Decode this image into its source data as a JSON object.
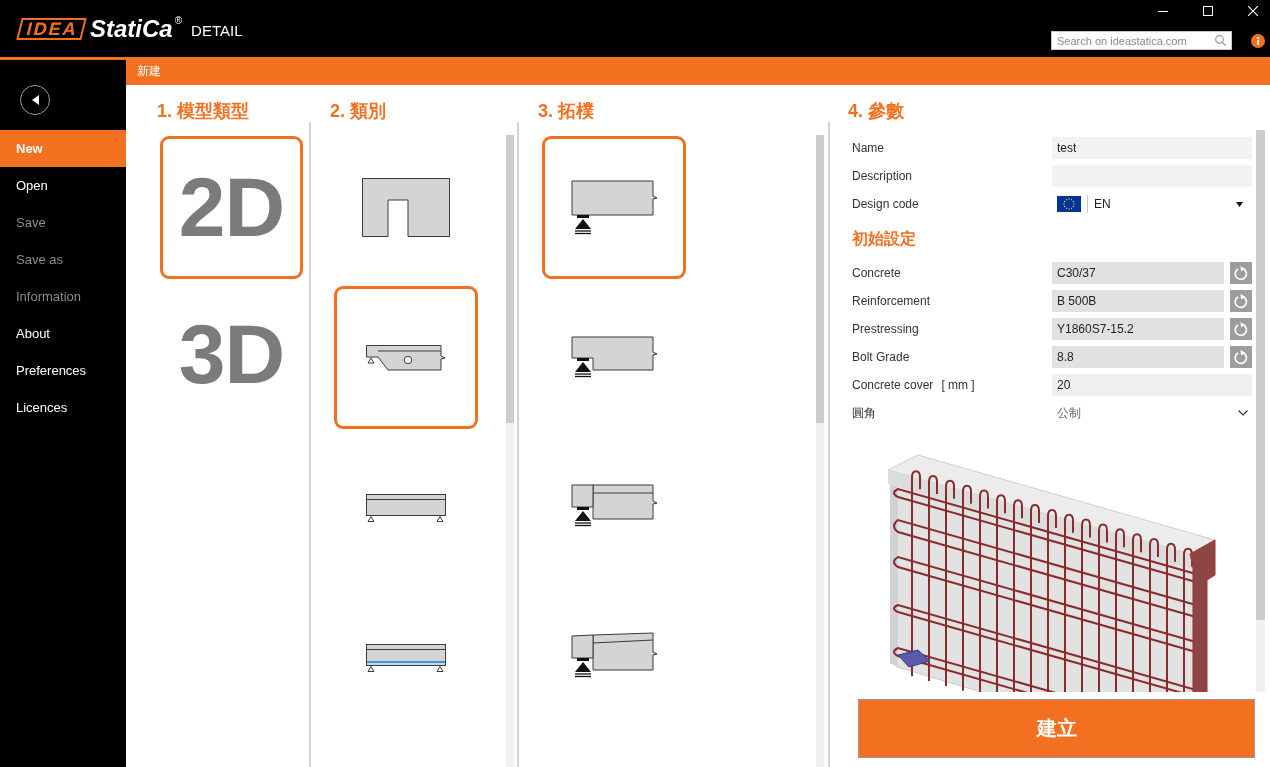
{
  "window": {
    "logo": {
      "brand": "IDEA",
      "name": "StatiCa",
      "mark": "®"
    },
    "product": "DETAIL",
    "search": {
      "placeholder": "Search on ideastatica.com"
    }
  },
  "breadcrumb": "新建",
  "sidebar": {
    "items": [
      {
        "label": "New",
        "selected": true,
        "disabled": false
      },
      {
        "label": "Open",
        "selected": false,
        "disabled": false
      },
      {
        "label": "Save",
        "selected": false,
        "disabled": true
      },
      {
        "label": "Save as",
        "selected": false,
        "disabled": true
      },
      {
        "label": "Information",
        "selected": false,
        "disabled": true
      },
      {
        "label": "About",
        "selected": false,
        "disabled": false
      },
      {
        "label": "Preferences",
        "selected": false,
        "disabled": false
      },
      {
        "label": "Licences",
        "selected": false,
        "disabled": false
      }
    ]
  },
  "model_types": {
    "title": "1. 模型類型",
    "items": [
      {
        "label": "2D",
        "selected": true
      },
      {
        "label": "3D",
        "selected": false
      }
    ]
  },
  "categories": {
    "title": "2. 類別",
    "items": [
      {
        "kind": "opening",
        "selected": false
      },
      {
        "kind": "end-block",
        "selected": true
      },
      {
        "kind": "beam",
        "selected": false
      },
      {
        "kind": "prestressed",
        "selected": false
      }
    ]
  },
  "topologies": {
    "title": "3. 拓樸",
    "items": [
      {
        "kind": "bearing",
        "selected": true
      },
      {
        "kind": "dapped",
        "selected": false
      },
      {
        "kind": "ledge",
        "selected": false
      },
      {
        "kind": "tapered",
        "selected": false
      }
    ]
  },
  "parameters": {
    "title": "4. 參數",
    "fields": [
      {
        "kind": "text",
        "label": "Name",
        "value": "test"
      },
      {
        "kind": "text",
        "label": "Description"
      },
      {
        "kind": "code",
        "label": "Design code",
        "value": "EN"
      }
    ],
    "initial_settings": {
      "title": "初始設定",
      "fields": [
        {
          "kind": "material",
          "label": "Concrete",
          "value": "C30/37"
        },
        {
          "kind": "material",
          "label": "Reinforcement",
          "value": "B 500B"
        },
        {
          "kind": "material",
          "label": "Prestressing",
          "value": "Y1860S7-15.2"
        },
        {
          "kind": "material",
          "label": "Bolt Grade",
          "value": "8.8"
        },
        {
          "kind": "number",
          "label": "Concrete cover",
          "unit": "[ mm ]",
          "value": "20"
        },
        {
          "kind": "select",
          "label": "圓角",
          "value": "公制"
        }
      ]
    }
  },
  "create_button": "建立"
}
